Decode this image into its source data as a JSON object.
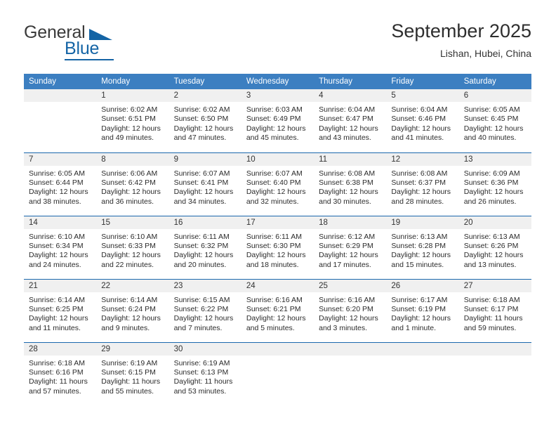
{
  "brand": {
    "name_part1": "General",
    "name_part2": "Blue",
    "accent_color": "#1464a5",
    "triangle_icon": "triangle-icon"
  },
  "header": {
    "month_title": "September 2025",
    "location": "Lishan, Hubei, China"
  },
  "calendar": {
    "header_bg": "#3c7fc1",
    "weekday_headers": [
      "Sunday",
      "Monday",
      "Tuesday",
      "Wednesday",
      "Thursday",
      "Friday",
      "Saturday"
    ],
    "weeks": [
      [
        {
          "day": "",
          "lines": []
        },
        {
          "day": "1",
          "lines": [
            "Sunrise: 6:02 AM",
            "Sunset: 6:51 PM",
            "Daylight: 12 hours",
            "and 49 minutes."
          ]
        },
        {
          "day": "2",
          "lines": [
            "Sunrise: 6:02 AM",
            "Sunset: 6:50 PM",
            "Daylight: 12 hours",
            "and 47 minutes."
          ]
        },
        {
          "day": "3",
          "lines": [
            "Sunrise: 6:03 AM",
            "Sunset: 6:49 PM",
            "Daylight: 12 hours",
            "and 45 minutes."
          ]
        },
        {
          "day": "4",
          "lines": [
            "Sunrise: 6:04 AM",
            "Sunset: 6:47 PM",
            "Daylight: 12 hours",
            "and 43 minutes."
          ]
        },
        {
          "day": "5",
          "lines": [
            "Sunrise: 6:04 AM",
            "Sunset: 6:46 PM",
            "Daylight: 12 hours",
            "and 41 minutes."
          ]
        },
        {
          "day": "6",
          "lines": [
            "Sunrise: 6:05 AM",
            "Sunset: 6:45 PM",
            "Daylight: 12 hours",
            "and 40 minutes."
          ]
        }
      ],
      [
        {
          "day": "7",
          "lines": [
            "Sunrise: 6:05 AM",
            "Sunset: 6:44 PM",
            "Daylight: 12 hours",
            "and 38 minutes."
          ]
        },
        {
          "day": "8",
          "lines": [
            "Sunrise: 6:06 AM",
            "Sunset: 6:42 PM",
            "Daylight: 12 hours",
            "and 36 minutes."
          ]
        },
        {
          "day": "9",
          "lines": [
            "Sunrise: 6:07 AM",
            "Sunset: 6:41 PM",
            "Daylight: 12 hours",
            "and 34 minutes."
          ]
        },
        {
          "day": "10",
          "lines": [
            "Sunrise: 6:07 AM",
            "Sunset: 6:40 PM",
            "Daylight: 12 hours",
            "and 32 minutes."
          ]
        },
        {
          "day": "11",
          "lines": [
            "Sunrise: 6:08 AM",
            "Sunset: 6:38 PM",
            "Daylight: 12 hours",
            "and 30 minutes."
          ]
        },
        {
          "day": "12",
          "lines": [
            "Sunrise: 6:08 AM",
            "Sunset: 6:37 PM",
            "Daylight: 12 hours",
            "and 28 minutes."
          ]
        },
        {
          "day": "13",
          "lines": [
            "Sunrise: 6:09 AM",
            "Sunset: 6:36 PM",
            "Daylight: 12 hours",
            "and 26 minutes."
          ]
        }
      ],
      [
        {
          "day": "14",
          "lines": [
            "Sunrise: 6:10 AM",
            "Sunset: 6:34 PM",
            "Daylight: 12 hours",
            "and 24 minutes."
          ]
        },
        {
          "day": "15",
          "lines": [
            "Sunrise: 6:10 AM",
            "Sunset: 6:33 PM",
            "Daylight: 12 hours",
            "and 22 minutes."
          ]
        },
        {
          "day": "16",
          "lines": [
            "Sunrise: 6:11 AM",
            "Sunset: 6:32 PM",
            "Daylight: 12 hours",
            "and 20 minutes."
          ]
        },
        {
          "day": "17",
          "lines": [
            "Sunrise: 6:11 AM",
            "Sunset: 6:30 PM",
            "Daylight: 12 hours",
            "and 18 minutes."
          ]
        },
        {
          "day": "18",
          "lines": [
            "Sunrise: 6:12 AM",
            "Sunset: 6:29 PM",
            "Daylight: 12 hours",
            "and 17 minutes."
          ]
        },
        {
          "day": "19",
          "lines": [
            "Sunrise: 6:13 AM",
            "Sunset: 6:28 PM",
            "Daylight: 12 hours",
            "and 15 minutes."
          ]
        },
        {
          "day": "20",
          "lines": [
            "Sunrise: 6:13 AM",
            "Sunset: 6:26 PM",
            "Daylight: 12 hours",
            "and 13 minutes."
          ]
        }
      ],
      [
        {
          "day": "21",
          "lines": [
            "Sunrise: 6:14 AM",
            "Sunset: 6:25 PM",
            "Daylight: 12 hours",
            "and 11 minutes."
          ]
        },
        {
          "day": "22",
          "lines": [
            "Sunrise: 6:14 AM",
            "Sunset: 6:24 PM",
            "Daylight: 12 hours",
            "and 9 minutes."
          ]
        },
        {
          "day": "23",
          "lines": [
            "Sunrise: 6:15 AM",
            "Sunset: 6:22 PM",
            "Daylight: 12 hours",
            "and 7 minutes."
          ]
        },
        {
          "day": "24",
          "lines": [
            "Sunrise: 6:16 AM",
            "Sunset: 6:21 PM",
            "Daylight: 12 hours",
            "and 5 minutes."
          ]
        },
        {
          "day": "25",
          "lines": [
            "Sunrise: 6:16 AM",
            "Sunset: 6:20 PM",
            "Daylight: 12 hours",
            "and 3 minutes."
          ]
        },
        {
          "day": "26",
          "lines": [
            "Sunrise: 6:17 AM",
            "Sunset: 6:19 PM",
            "Daylight: 12 hours",
            "and 1 minute."
          ]
        },
        {
          "day": "27",
          "lines": [
            "Sunrise: 6:18 AM",
            "Sunset: 6:17 PM",
            "Daylight: 11 hours",
            "and 59 minutes."
          ]
        }
      ],
      [
        {
          "day": "28",
          "lines": [
            "Sunrise: 6:18 AM",
            "Sunset: 6:16 PM",
            "Daylight: 11 hours",
            "and 57 minutes."
          ]
        },
        {
          "day": "29",
          "lines": [
            "Sunrise: 6:19 AM",
            "Sunset: 6:15 PM",
            "Daylight: 11 hours",
            "and 55 minutes."
          ]
        },
        {
          "day": "30",
          "lines": [
            "Sunrise: 6:19 AM",
            "Sunset: 6:13 PM",
            "Daylight: 11 hours",
            "and 53 minutes."
          ]
        },
        {
          "day": "",
          "lines": []
        },
        {
          "day": "",
          "lines": []
        },
        {
          "day": "",
          "lines": []
        },
        {
          "day": "",
          "lines": []
        }
      ]
    ]
  }
}
